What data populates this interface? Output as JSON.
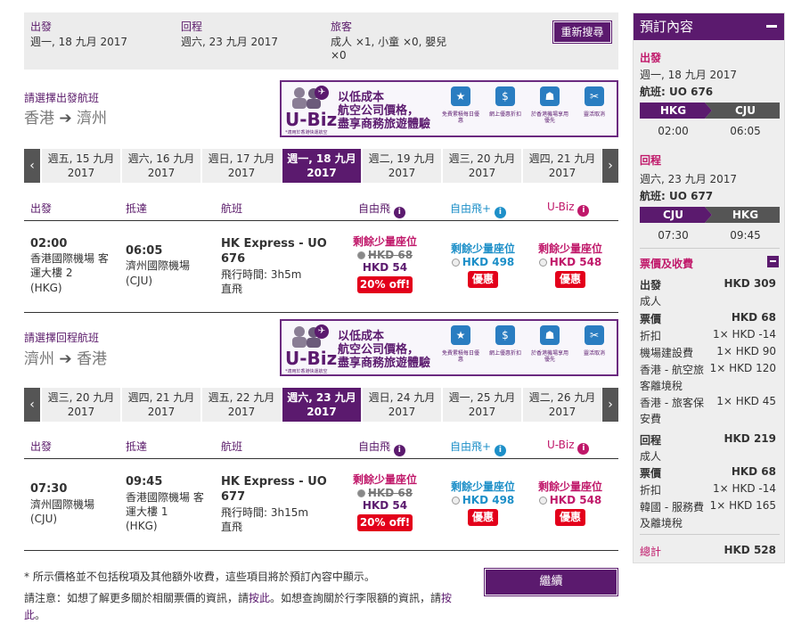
{
  "summary": {
    "depart_label": "出發",
    "depart_date": "週一, 18 九月 2017",
    "return_label": "回程",
    "return_date": "週六, 23 九月 2017",
    "pax_label": "旅客",
    "pax_value": "成人 ×1, 小童 ×0, 嬰兒",
    "pax_value2": "×0",
    "research_button": "重新搜尋"
  },
  "banner": {
    "brand": "U-Biz",
    "line1": "以低成本",
    "line2": "航空公司價格，",
    "line3": "盡享商務旅遊體驗",
    "benefit1": "免費累積每日優惠",
    "benefit2": "網上優惠折扣",
    "benefit3": "於香港機場享用優先",
    "benefit4": "靈活取消",
    "note": "*適用於香港快運航空"
  },
  "outbound": {
    "title": "請選擇出發航班",
    "from": "香港",
    "to": "濟州",
    "dates": [
      {
        "day": "週五, 15 九月",
        "year": "2017"
      },
      {
        "day": "週六, 16 九月",
        "year": "2017"
      },
      {
        "day": "週日, 17 九月",
        "year": "2017"
      },
      {
        "day": "週一, 18 九月",
        "year": "2017"
      },
      {
        "day": "週二, 19 九月",
        "year": "2017"
      },
      {
        "day": "週三, 20 九月",
        "year": "2017"
      },
      {
        "day": "週四, 21 九月",
        "year": "2017"
      }
    ],
    "headers": {
      "depart": "出發",
      "arrive": "抵達",
      "flight": "航班",
      "fare1": "自由飛",
      "fare2": "自由飛+",
      "fare3": "U-Biz"
    },
    "flight": {
      "dep_time": "02:00",
      "dep_airport1": "香港國際機場 客",
      "dep_airport2": "運大樓 2",
      "dep_code": "(HKG)",
      "arr_time": "06:05",
      "arr_airport": "濟州國際機場",
      "arr_code": "(CJU)",
      "airline1": "HK Express - UO",
      "airline2": "676",
      "duration": "飛行時間: 3h5m",
      "type": "直飛",
      "fare1_seats": "剩餘少量座位",
      "fare1_old": "HKD 68",
      "fare1_new": "HKD 54",
      "fare1_badge": "20% off!",
      "fare2_seats": "剩餘少量座位",
      "fare2_price": "HKD 498",
      "fare2_badge": "優惠",
      "fare3_seats": "剩餘少量座位",
      "fare3_price": "HKD 548",
      "fare3_badge": "優惠"
    }
  },
  "inbound": {
    "title": "請選擇回程航班",
    "from": "濟州",
    "to": "香港",
    "dates": [
      {
        "day": "週三, 20 九月",
        "year": "2017"
      },
      {
        "day": "週四, 21 九月",
        "year": "2017"
      },
      {
        "day": "週五, 22 九月",
        "year": "2017"
      },
      {
        "day": "週六, 23 九月",
        "year": "2017"
      },
      {
        "day": "週日, 24 九月",
        "year": "2017"
      },
      {
        "day": "週一, 25 九月",
        "year": "2017"
      },
      {
        "day": "週二, 26 九月",
        "year": "2017"
      }
    ],
    "headers": {
      "depart": "出發",
      "arrive": "抵達",
      "flight": "航班",
      "fare1": "自由飛",
      "fare2": "自由飛+",
      "fare3": "U-Biz"
    },
    "flight": {
      "dep_time": "07:30",
      "dep_airport1": "濟州國際機場",
      "dep_code": "(CJU)",
      "arr_time": "09:45",
      "arr_airport1": "香港國際機場 客",
      "arr_airport2": "運大樓 1",
      "arr_code": "(HKG)",
      "airline1": "HK Express - UO",
      "airline2": "677",
      "duration": "飛行時間: 3h15m",
      "type": "直飛",
      "fare1_seats": "剩餘少量座位",
      "fare1_old": "HKD 68",
      "fare1_new": "HKD 54",
      "fare1_badge": "20% off!",
      "fare2_seats": "剩餘少量座位",
      "fare2_price": "HKD 498",
      "fare2_badge": "優惠",
      "fare3_seats": "剩餘少量座位",
      "fare3_price": "HKD 548",
      "fare3_badge": "優惠"
    }
  },
  "footer": {
    "note1": "* 所示價格並不包括稅項及其他額外收費，這些項目將於預訂內容中顯示。",
    "note2a": "請注意：如想了解更多關於相關票價的資訊，請",
    "link1": "按此",
    "note2b": "。如想查詢關於行李限額的資訊，請",
    "link2a": "按",
    "link2b": "此",
    "note2c": "。",
    "continue_button": "繼續"
  },
  "sidebar": {
    "title": "預訂內容",
    "depart_label": "出發",
    "depart_date": "週一, 18 九月 2017",
    "depart_flight": "航班: UO 676",
    "depart_from": "HKG",
    "depart_to": "CJU",
    "depart_from_time": "02:00",
    "depart_to_time": "06:05",
    "return_label": "回程",
    "return_date": "週六, 23 九月 2017",
    "return_flight": "航班: UO 677",
    "return_from": "CJU",
    "return_to": "HKG",
    "return_from_time": "07:30",
    "return_to_time": "09:45",
    "fees_label": "票價及收費",
    "out_label": "出發",
    "out_total": "HKD 309",
    "out_pax": "成人",
    "out_fare_label": "票價",
    "out_fare": "HKD 68",
    "out_rows": [
      {
        "name": "折扣",
        "val": "1× HKD -14"
      },
      {
        "name": "機場建設費",
        "val": "1× HKD 90"
      },
      {
        "name": "香港 - 航空旅",
        "name2": "客離境稅",
        "val": "1× HKD 120"
      },
      {
        "name": "香港 - 旅客保",
        "name2": "安費",
        "val": "1× HKD 45"
      }
    ],
    "ret_label": "回程",
    "ret_total": "HKD 219",
    "ret_pax": "成人",
    "ret_fare_label": "票價",
    "ret_fare": "HKD 68",
    "ret_rows": [
      {
        "name": "折扣",
        "val": "1× HKD -14"
      },
      {
        "name": "韓國 - 服務費",
        "name2": "及離境稅",
        "val": "1× HKD 165"
      }
    ],
    "total_label": "總計",
    "total_value": "HKD 528"
  },
  "colors": {
    "brand": "#5b1a6e",
    "fare_red": "#c0186a",
    "fare_blue": "#1d8fc8",
    "badge": "#e3001b"
  }
}
